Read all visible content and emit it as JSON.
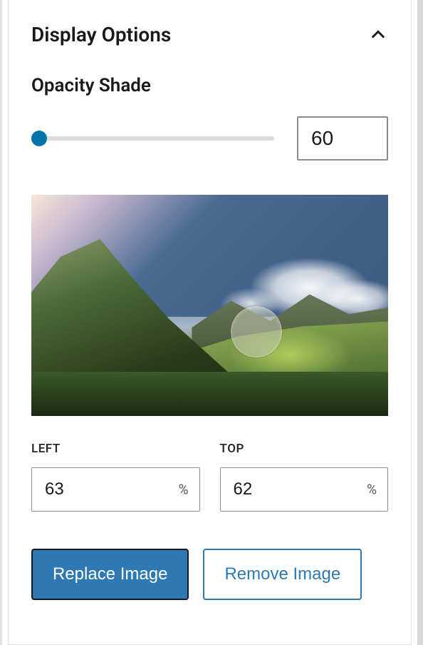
{
  "panel": {
    "title": "Display Options"
  },
  "opacity": {
    "label": "Opacity Shade",
    "value": "60"
  },
  "focal": {
    "left_label": "LEFT",
    "left_value": "63",
    "left_unit": "%",
    "top_label": "TOP",
    "top_value": "62",
    "top_unit": "%"
  },
  "buttons": {
    "replace": "Replace Image",
    "remove": "Remove Image"
  },
  "colors": {
    "primary": "#2e79b3",
    "slider_thumb": "#0073aa"
  }
}
